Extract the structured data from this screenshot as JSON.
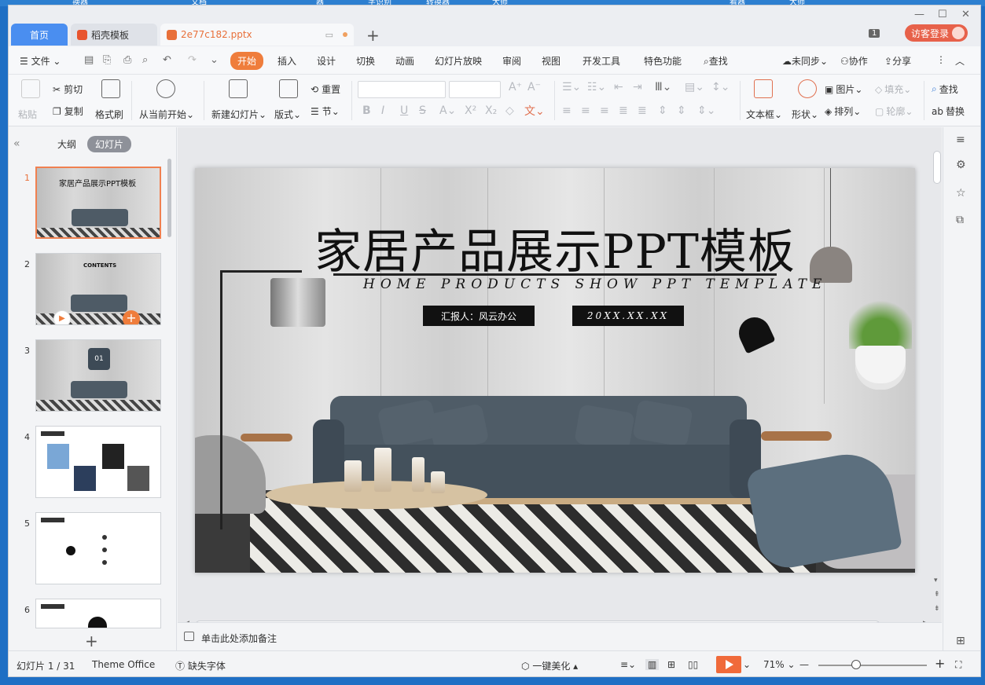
{
  "desktop": {
    "fragments": [
      "换器",
      "文档",
      "器",
      "字识别",
      "转换器",
      "大师",
      "看器",
      "大师"
    ]
  },
  "tabs": {
    "home": "首页",
    "daoke": "稻壳模板",
    "file": "2e77c182.pptx",
    "new_tab": "+"
  },
  "window": {
    "badge": "1",
    "login": "访客登录"
  },
  "menu": {
    "file": "文件",
    "items": [
      "开始",
      "插入",
      "设计",
      "切换",
      "动画",
      "幻灯片放映",
      "审阅",
      "视图",
      "开发工具",
      "特色功能"
    ],
    "search": "查找",
    "sync": "未同步",
    "collab": "协作",
    "share": "分享"
  },
  "ribbon": {
    "paste": "粘贴",
    "cut": "剪切",
    "copy": "复制",
    "format_painter": "格式刷",
    "from_current": "从当前开始",
    "new_slide": "新建幻灯片",
    "layout": "版式",
    "reset": "重置",
    "section": "节",
    "text_box": "文本框",
    "shape": "形状",
    "picture": "图片",
    "arrange": "排列",
    "fill": "填充",
    "outline": "轮廓",
    "find": "查找",
    "replace": "替换"
  },
  "leftpanel": {
    "outline_tab": "大纲",
    "slides_tab": "幻灯片",
    "thumbs": [
      {
        "num": "1",
        "title": "家居产品展示PPT模板"
      },
      {
        "num": "2",
        "title": "CONTENTS"
      },
      {
        "num": "3",
        "title": "01"
      },
      {
        "num": "4",
        "title": ""
      },
      {
        "num": "5",
        "title": ""
      },
      {
        "num": "6",
        "title": ""
      }
    ]
  },
  "slide": {
    "title": "家居产品展示PPT模板",
    "subtitle": "HOME PRODUCTS SHOW PPT TEMPLATE",
    "reporter": "汇报人：风云办公",
    "date": "20XX.XX.XX"
  },
  "notes": {
    "placeholder": "单击此处添加备注"
  },
  "status": {
    "slide_counter": "幻灯片 1 / 31",
    "theme": "Theme Office",
    "missing_font": "缺失字体",
    "beautify": "一键美化",
    "zoom": "71%"
  },
  "colors": {
    "accent": "#ef7d3c",
    "home_tab": "#4a8ef0",
    "login": "#e7614a"
  }
}
